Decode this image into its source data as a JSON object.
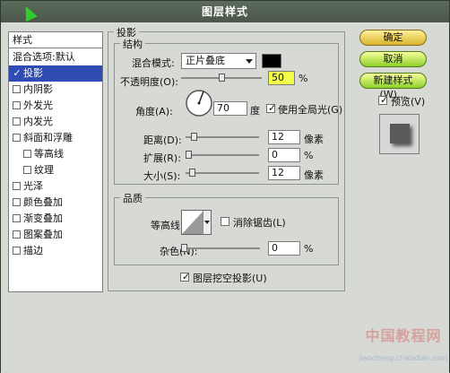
{
  "window": {
    "title": "图层样式"
  },
  "styles_list": {
    "header": "样式",
    "items": [
      {
        "label": "混合选项:默认",
        "has_checkbox": false,
        "checked": false,
        "indent": 0
      },
      {
        "label": "投影",
        "has_checkbox": true,
        "checked": true,
        "indent": 0,
        "selected": true
      },
      {
        "label": "内阴影",
        "has_checkbox": true,
        "checked": false,
        "indent": 0
      },
      {
        "label": "外发光",
        "has_checkbox": true,
        "checked": false,
        "indent": 0
      },
      {
        "label": "内发光",
        "has_checkbox": true,
        "checked": false,
        "indent": 0
      },
      {
        "label": "斜面和浮雕",
        "has_checkbox": true,
        "checked": false,
        "indent": 0
      },
      {
        "label": "等高线",
        "has_checkbox": true,
        "checked": false,
        "indent": 1
      },
      {
        "label": "纹理",
        "has_checkbox": true,
        "checked": false,
        "indent": 1
      },
      {
        "label": "光泽",
        "has_checkbox": true,
        "checked": false,
        "indent": 0
      },
      {
        "label": "颜色叠加",
        "has_checkbox": true,
        "checked": false,
        "indent": 0
      },
      {
        "label": "渐变叠加",
        "has_checkbox": true,
        "checked": false,
        "indent": 0
      },
      {
        "label": "图案叠加",
        "has_checkbox": true,
        "checked": false,
        "indent": 0
      },
      {
        "label": "描边",
        "has_checkbox": true,
        "checked": false,
        "indent": 0
      }
    ]
  },
  "shadow_panel": {
    "title": "投影",
    "structure": {
      "title": "结构",
      "blend_mode_label": "混合模式:",
      "blend_mode_value": "正片叠底",
      "opacity_label": "不透明度(O):",
      "opacity_value": "50",
      "opacity_unit": "%",
      "angle_label": "角度(A):",
      "angle_value": "70",
      "angle_unit": "度",
      "use_global_light_label": "使用全局光(G)",
      "use_global_light_checked": true,
      "distance_label": "距离(D):",
      "distance_value": "12",
      "distance_unit": "像素",
      "spread_label": "扩展(R):",
      "spread_value": "0",
      "spread_unit": "%",
      "size_label": "大小(S):",
      "size_value": "12",
      "size_unit": "像素"
    },
    "quality": {
      "title": "品质",
      "contour_label": "等高线:",
      "antialias_label": "消除锯齿(L)",
      "antialias_checked": false,
      "noise_label": "杂色(N):",
      "noise_value": "0",
      "noise_unit": "%"
    },
    "layer_knocks_out_label": "图层挖空投影(U)",
    "layer_knocks_out_checked": true
  },
  "buttons": {
    "ok": "确定",
    "cancel": "取消",
    "new_style": "新建样式(W)..."
  },
  "preview": {
    "label": "预览(V)",
    "checked": true
  },
  "watermark": {
    "top": "中国教程网",
    "bottom": "jiaocheng.chazidian.com"
  }
}
